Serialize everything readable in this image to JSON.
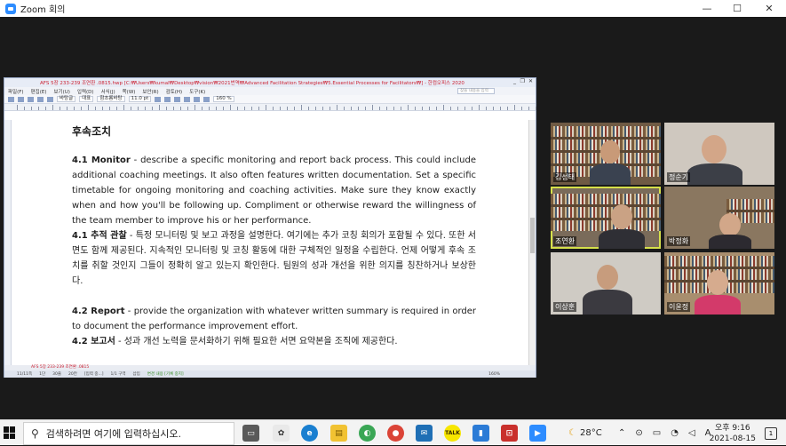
{
  "window": {
    "title": "Zoom 회의",
    "controls": [
      "—",
      "☐",
      "✕"
    ]
  },
  "document": {
    "title_bar": "AFS 5장 233-239 조연환 .0815.hwp [C:₩Users₩kumal₩Desktop₩vision₩2021번역₩Advanced Facilitation Strategies₩5.Essential Processes for Facilitators₩] - 한컴오피스 2020",
    "title_controls": [
      "_",
      "❐",
      "✕"
    ],
    "menu": [
      "파일(F)",
      "편집(E)",
      "보기(U)",
      "입력(D)",
      "서식(J)",
      "쪽(W)",
      "보안(R)",
      "검토(H)",
      "도구(K)"
    ],
    "search_placeholder": "찾을 내용을 입력",
    "toolbar": {
      "style_box": "바탕글",
      "lang_box": "대표",
      "font_box": "함초롬바탕",
      "size_box": "11.0 pt",
      "zoom_box": "160 %"
    },
    "heading": "후속조치",
    "paragraphs": [
      {
        "lead": "4.1 Monitor",
        "text": " - describe a specific monitoring and report back process. This could include additional coaching meetings. It also often features written documentation. Set a specific timetable for ongoing monitoring and coaching activities. Make sure they know exactly when and how you'll be following up. Compliment or otherwise reward the willingness of the team member to improve his or her performance."
      },
      {
        "lead": "4.1 추적 관찰",
        "text": " - 특정 모니터링 및 보고 과정을 설명한다. 여기에는 추가 코칭 회의가 포함될 수 있다. 또한 서면도 함께 제공된다. 지속적인 모니터링 및 코칭 활동에 대한 구체적인 일정을 수립한다. 언제 어떻게 후속 조치를 취할 것인지 그들이 정확히 알고 있는지 확인한다. 팀원의 성과 개선을 위한 의지를 칭찬하거나 보상한다."
      },
      {
        "lead": "4.2 Report",
        "text": " - provide the organization with whatever written summary is required in order to document the performance improvement effort."
      },
      {
        "lead": "4.2 보고서",
        "text": " - 성과 개선 노력을 문서화하기 위해 필요한 서면 요약본을 조직에 제공한다."
      }
    ],
    "tab_label": "AFS 5장 233-239 조연환 .0815",
    "status": [
      "11/11쪽",
      "1단",
      "30줄",
      "20칸",
      "[입력 중...]",
      "1/1 구역",
      "삽입",
      "변경 내용 [기록 중지]",
      "160%"
    ]
  },
  "participants": [
    {
      "name": "김성태",
      "active": false
    },
    {
      "name": "정순기",
      "active": false
    },
    {
      "name": "조연환",
      "active": true
    },
    {
      "name": "박정화",
      "active": false
    },
    {
      "name": "이상훈",
      "active": false
    },
    {
      "name": "이윤정",
      "active": false
    }
  ],
  "taskbar": {
    "search_placeholder": "검색하려면 여기에 입력하십시오.",
    "weather": "28°C",
    "ime": "A",
    "time": "오후 9:16",
    "date": "2021-08-15",
    "notifications": "1"
  }
}
